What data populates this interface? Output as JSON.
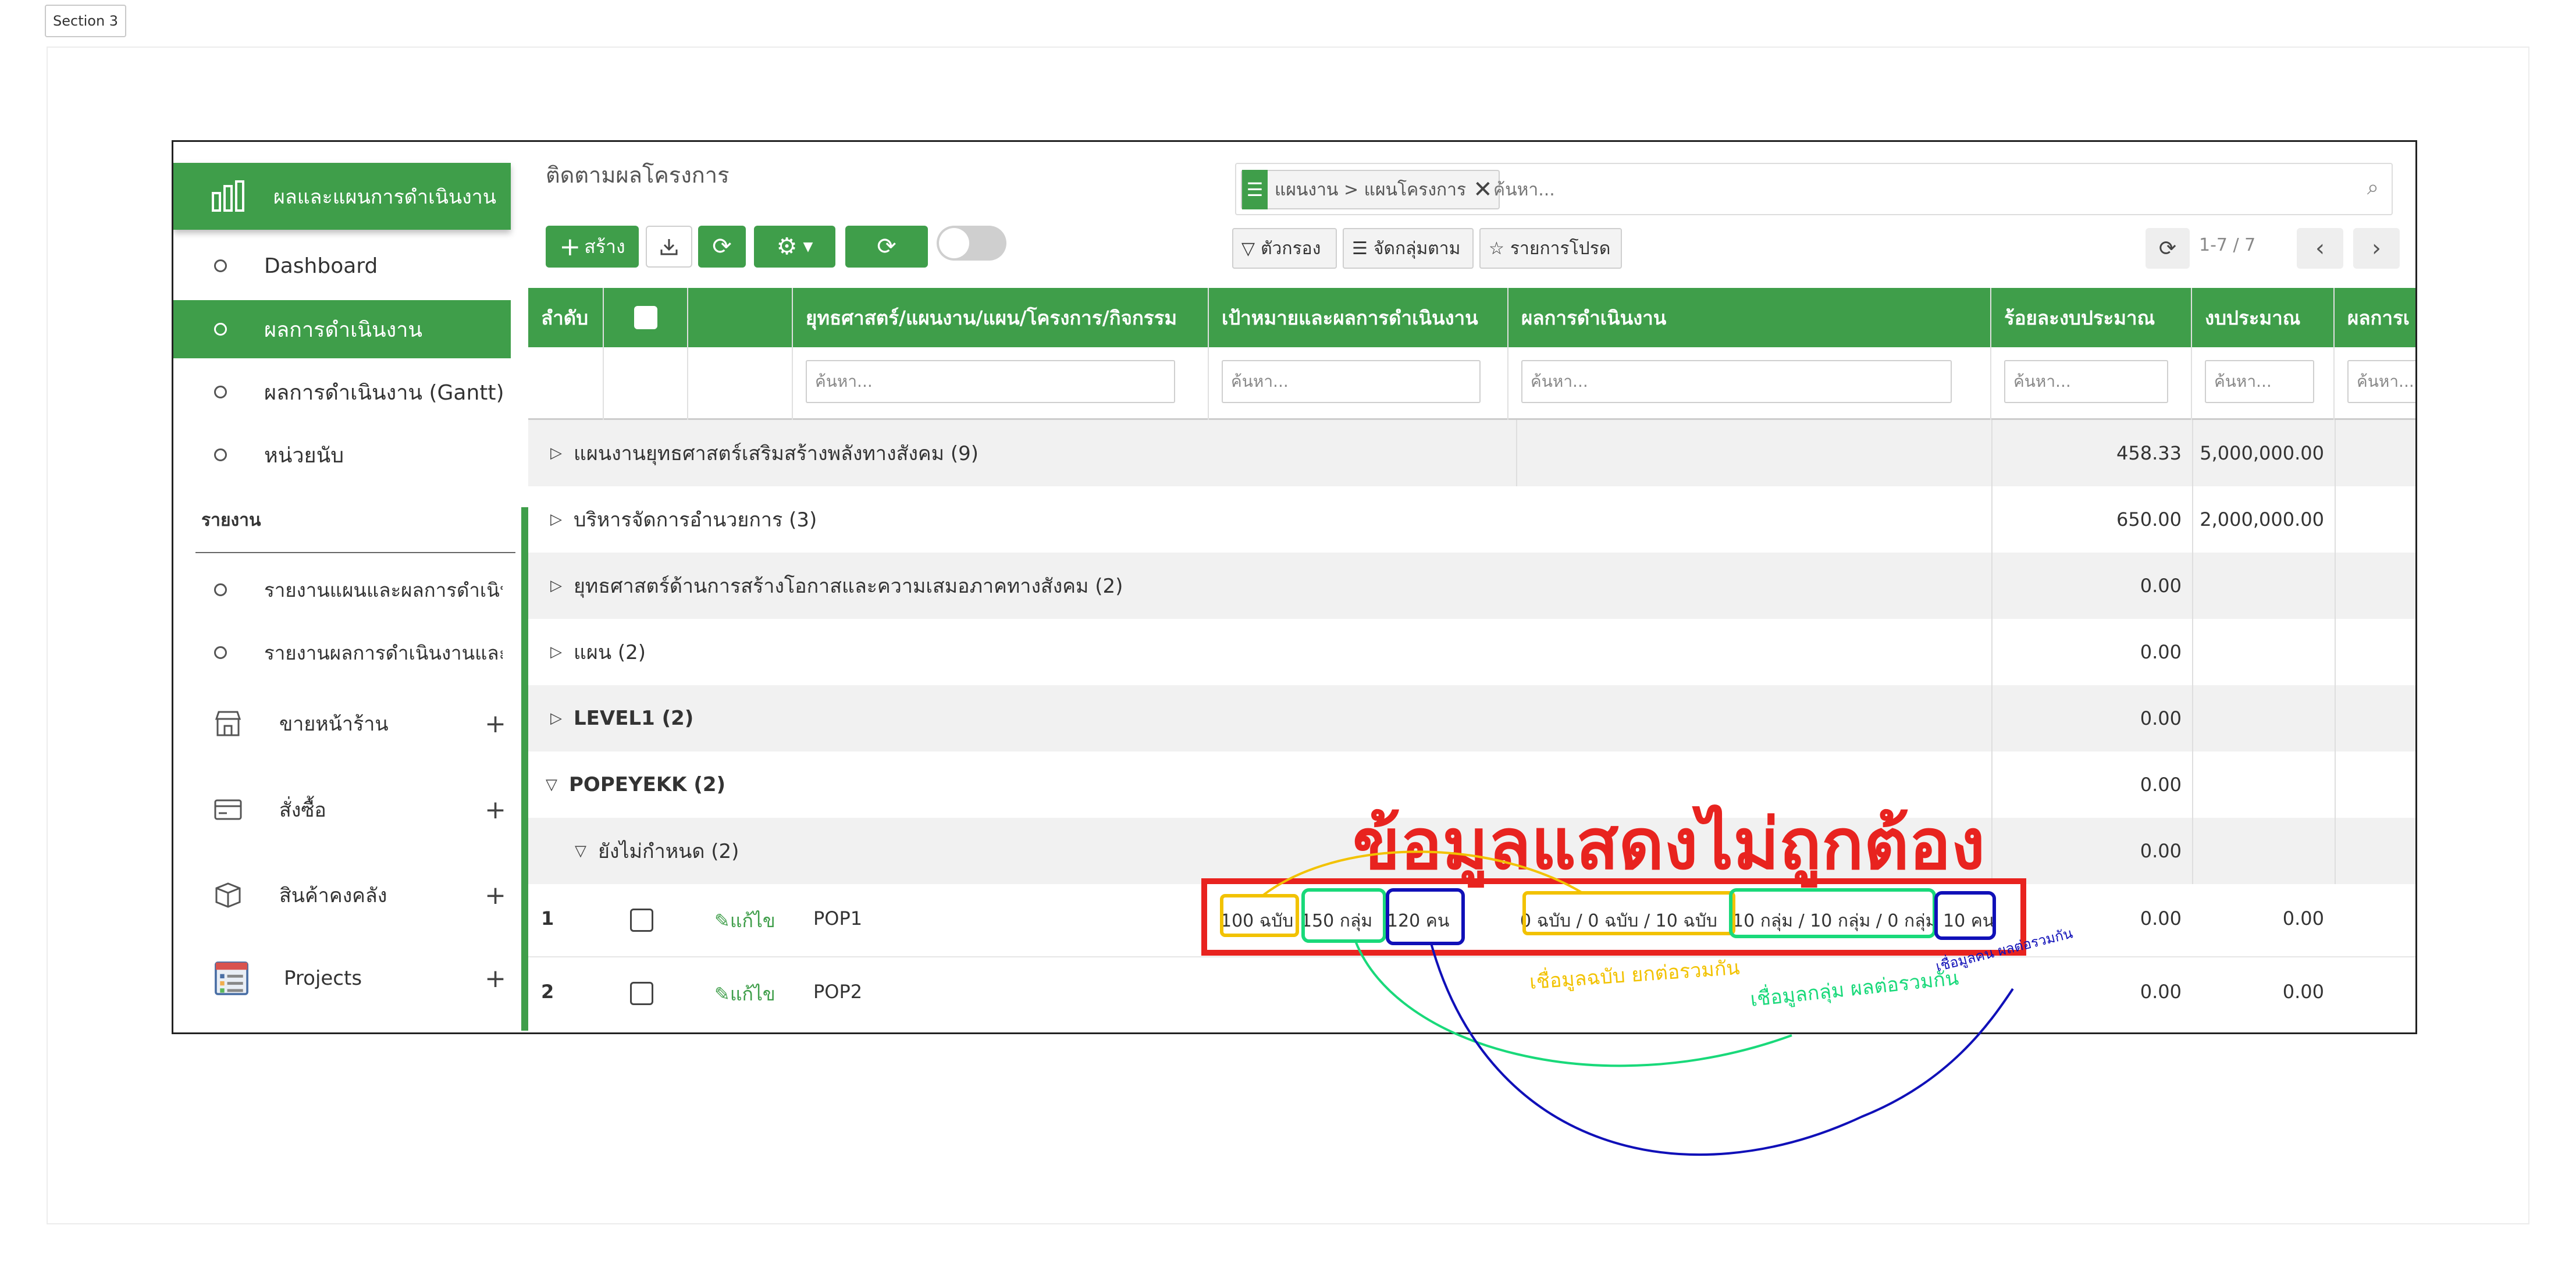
{
  "section_label": "Section 3",
  "sidebar": {
    "top_label": "ผลและแผนการดำเนินงาน",
    "items": [
      {
        "label": "Dashboard",
        "active": false
      },
      {
        "label": "ผลการดำเนินงาน",
        "active": true
      },
      {
        "label": "ผลการดำเนินงาน (Gantt)",
        "active": false
      },
      {
        "label": "หน่วยนับ",
        "active": false
      }
    ],
    "report_heading": "รายงาน",
    "report_items": [
      {
        "label": "รายงานแผนและผลการดำเนิน"
      },
      {
        "label": "รายงานผลการดำเนินงานและr"
      }
    ],
    "groups": [
      {
        "label": "ขายหน้าร้าน",
        "icon": "store-icon"
      },
      {
        "label": "สั่งซื้อ",
        "icon": "card-icon"
      },
      {
        "label": "สินค้าคงคลัง",
        "icon": "box-icon"
      },
      {
        "label": "Projects",
        "icon": "projects-icon"
      }
    ]
  },
  "main": {
    "title": "ติดตามผลโครงการ",
    "create_label": "สร้าง",
    "facet_label": "แผนงาน > แผนโครงการ",
    "search_placeholder": "ค้นหา...",
    "filter_label": "ตัวกรอง",
    "groupby_label": "จัดกลุ่มตาม",
    "favorites_label": "รายการโปรด",
    "pager": "1-7 / 7"
  },
  "table": {
    "headers": [
      "ลำดับ",
      "",
      "",
      "ยุทธศาสตร์/แผนงาน/แผน/โครงการ/กิจกรรม",
      "เป้าหมายและผลการดำเนินงาน",
      "ผลการดำเนินงาน",
      "ร้อยละงบประมาณ",
      "งบประมาณ",
      "ผลการเ"
    ],
    "filter_placeholder": "ค้นหา...",
    "groups": [
      {
        "label": "แผนงานยุทธศาสตร์เสริมสร้างพลังทางสังคม (9)",
        "percent": "458.33",
        "budget": "5,000,000.00",
        "expanded": false
      },
      {
        "label": "บริหารจัดการอำนวยการ (3)",
        "percent": "650.00",
        "budget": "2,000,000.00",
        "expanded": false
      },
      {
        "label": "ยุทธศาสตร์ด้านการสร้างโอกาสและความเสมอภาคทางสังคม (2)",
        "percent": "0.00",
        "budget": "",
        "expanded": false
      },
      {
        "label": "แผน (2)",
        "percent": "0.00",
        "budget": "",
        "expanded": false
      },
      {
        "label": "LEVEL1 (2)",
        "percent": "0.00",
        "budget": "",
        "expanded": false
      },
      {
        "label": "POPEYEKK (2)",
        "percent": "0.00",
        "budget": "",
        "expanded": true
      }
    ],
    "subgroup": {
      "label": "ยังไม่กำหนด (2)",
      "percent": "0.00"
    },
    "rows": [
      {
        "index": "1",
        "edit": "แก้ไข",
        "name": "POP1",
        "target_a": "100 ฉบับ",
        "target_b": "150 กลุ่ม",
        "target_c": "120 คน",
        "result_a": "0 ฉบับ / 0 ฉบับ / 10 ฉบับ",
        "result_b": "10 กลุ่ม / 10 กลุ่ม / 0 กลุ่ม",
        "result_c": "10 คน",
        "percent": "0.00",
        "budget": "0.00"
      },
      {
        "index": "2",
        "edit": "แก้ไข",
        "name": "POP2",
        "target_a": "",
        "target_b": "",
        "target_c": "",
        "result_a": "",
        "result_b": "",
        "result_c": "",
        "percent": "0.00",
        "budget": "0.00"
      }
    ]
  },
  "annotation": {
    "title": "ข้อมูลแสดงไม่ถูกต้อง",
    "note_yellow": "เชื่อมูลฉบับ ยกต่อรวมกัน",
    "note_green": "เชื่อมูลกลุ่ม ผลต่อรวมกัน",
    "note_blue": "เชื่อมูลคน ผลต่อรวมกัน",
    "colors": {
      "red": "#e8231f",
      "yellow": "#f2c200",
      "green": "#19d97a",
      "blue": "#1010b8"
    }
  },
  "colors": {
    "brand_green": "#3f9e4a",
    "row_shade": "#f1f1f1",
    "header_text": "#ffffff"
  }
}
